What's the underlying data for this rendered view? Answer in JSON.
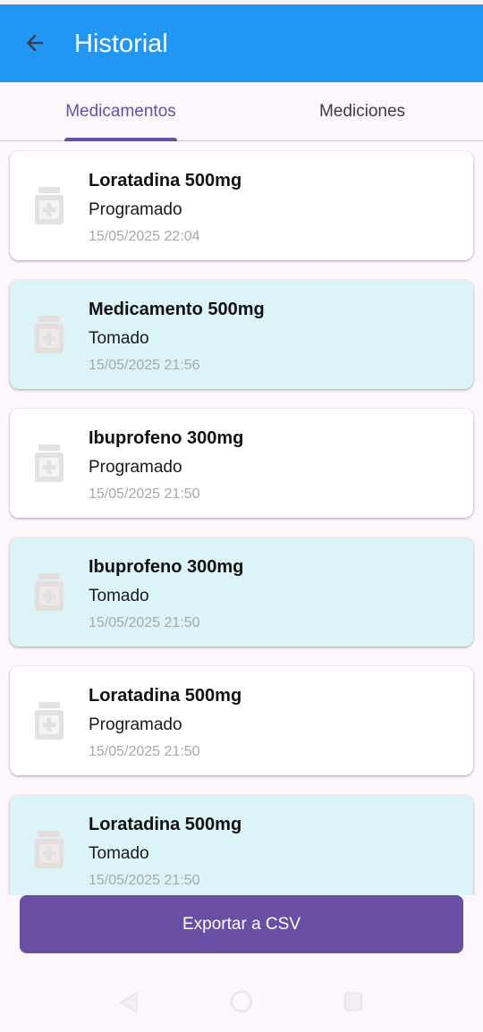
{
  "header": {
    "title": "Historial",
    "back_icon": "arrow-left-icon",
    "color": "#2196f3"
  },
  "tabs": [
    {
      "label": "Medicamentos",
      "selected": true
    },
    {
      "label": "Mediciones",
      "selected": false
    }
  ],
  "accent": "#6750a4",
  "records": [
    {
      "name": "Loratadina 500mg",
      "status": "Programado",
      "datetime": "15/05/2025 22:04",
      "background": "#ffffff"
    },
    {
      "name": "Medicamento 500mg",
      "status": "Tomado",
      "datetime": "15/05/2025 21:56",
      "background": "#dcf4f8"
    },
    {
      "name": "Ibuprofeno 300mg",
      "status": "Programado",
      "datetime": "15/05/2025 21:50",
      "background": "#ffffff"
    },
    {
      "name": "Ibuprofeno 300mg",
      "status": "Tomado",
      "datetime": "15/05/2025 21:50",
      "background": "#dcf4f8"
    },
    {
      "name": "Loratadina 500mg",
      "status": "Programado",
      "datetime": "15/05/2025 21:50",
      "background": "#ffffff"
    },
    {
      "name": "Loratadina 500mg",
      "status": "Tomado",
      "datetime": "15/05/2025 21:50",
      "background": "#dcf4f8"
    }
  ],
  "record_icon": "medicine-bottle-icon",
  "actions": {
    "export_label": "Exportar a CSV"
  },
  "system_nav": {
    "back_icon": "nav-back-icon",
    "home_icon": "nav-home-icon",
    "recents_icon": "nav-recents-icon"
  }
}
